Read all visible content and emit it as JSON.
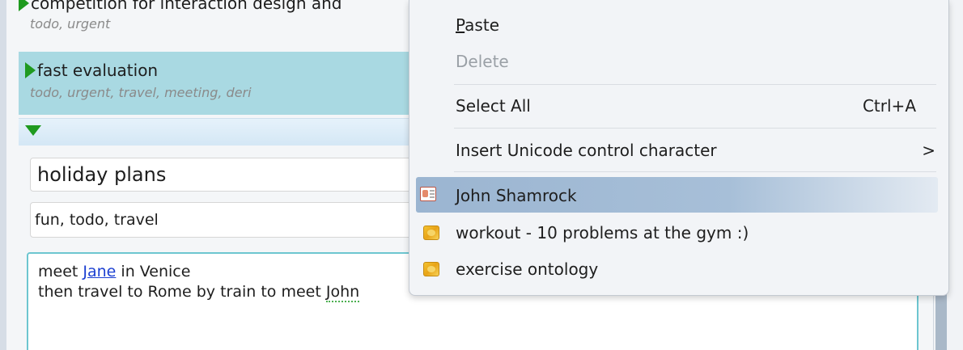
{
  "notes": {
    "items": [
      {
        "title": "competition for interaction design and",
        "tags": "todo, urgent"
      },
      {
        "title": "fast evaluation",
        "tags": "todo, urgent, travel, meeting, deri"
      }
    ]
  },
  "editor": {
    "title_value": "holiday plans",
    "tags_value": "fun, todo, travel",
    "body_line1_pre": "meet ",
    "body_link": "Jane",
    "body_line1_post": " in Venice",
    "body_line2_pre": "then travel to Rome by train to meet ",
    "body_line2_spell": "John"
  },
  "context_menu": {
    "paste_label_accel": "P",
    "paste_label_rest": "aste",
    "delete_label": "Delete",
    "select_all_label": "Select All",
    "select_all_shortcut": "Ctrl+A",
    "unicode_label": "Insert Unicode control character",
    "unicode_arrow": ">",
    "suggestions": [
      {
        "label": "John Shamrock",
        "icon": "contact-card-icon"
      },
      {
        "label": "workout - 10 problems at the gym :)",
        "icon": "note-icon"
      },
      {
        "label": "exercise ontology",
        "icon": "note-icon"
      }
    ]
  },
  "colors": {
    "selected_item_bg": "#a9d9e2",
    "menu_highlight": "#9bb5d1",
    "link": "#1b3fd1",
    "expand_triangle": "#1f9a1f"
  }
}
